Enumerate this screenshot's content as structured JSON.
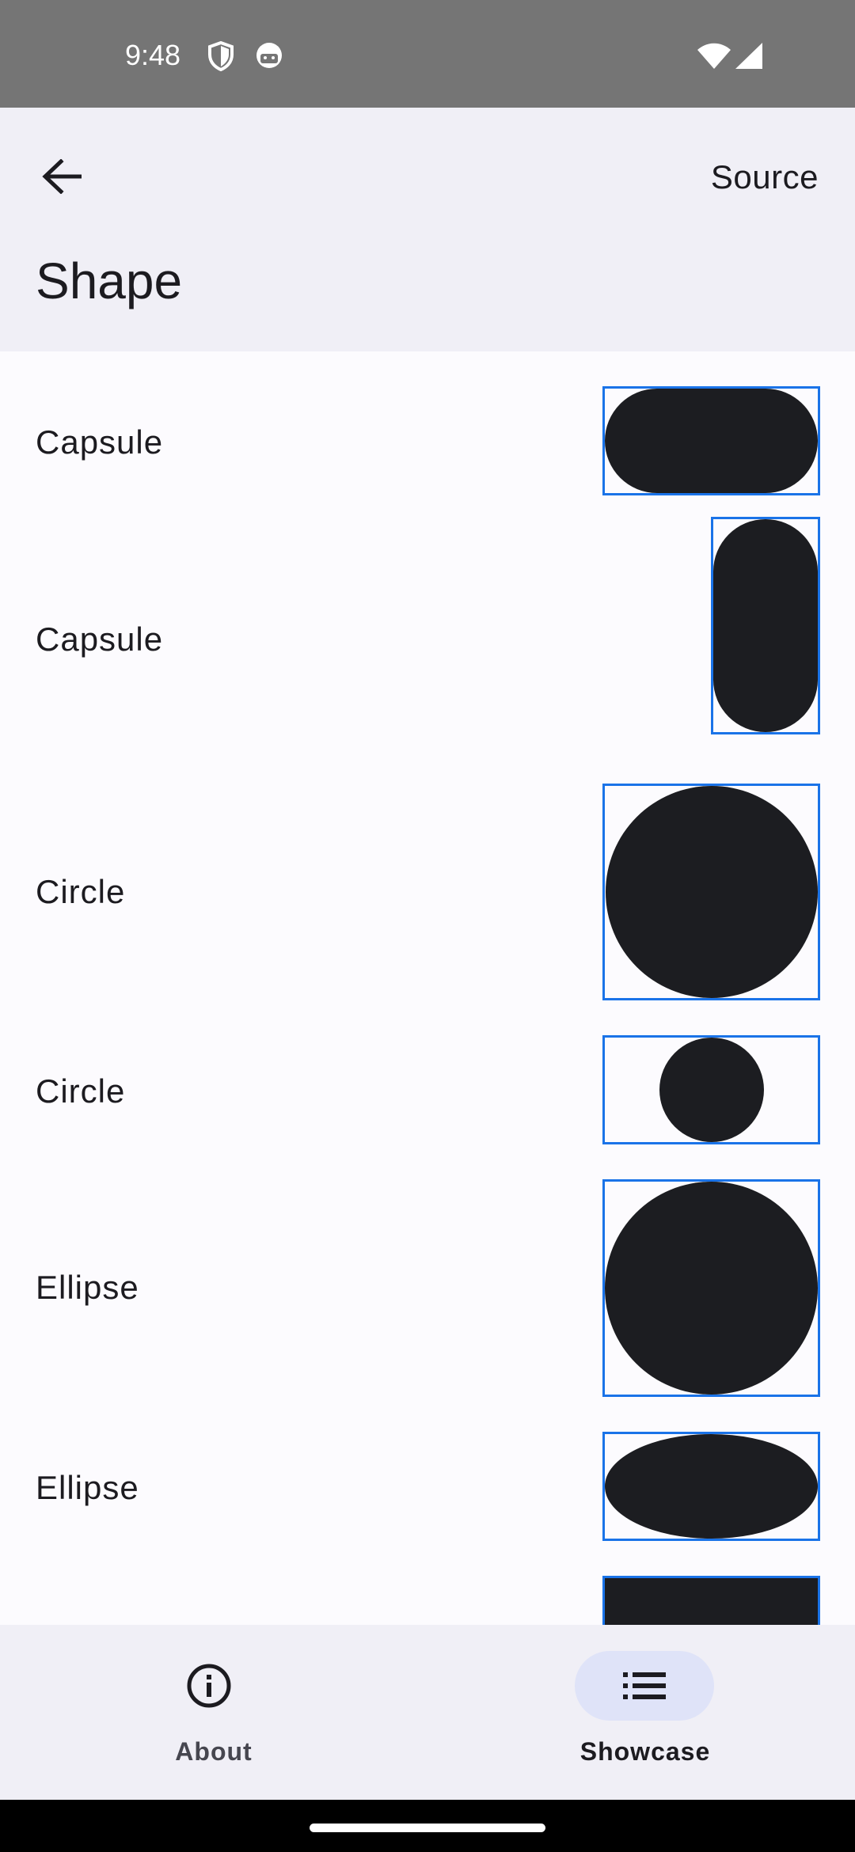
{
  "status_bar": {
    "time": "9:48",
    "icons": [
      "shield-icon",
      "android-face-icon",
      "wifi-icon",
      "signal-icon"
    ]
  },
  "top_bar": {
    "title": "Shape",
    "source_label": "Source",
    "back_icon": "arrow-left-icon"
  },
  "showcase_items": [
    {
      "label": "Capsule"
    },
    {
      "label": "Capsule"
    },
    {
      "label": "Circle"
    },
    {
      "label": "Circle"
    },
    {
      "label": "Ellipse"
    },
    {
      "label": "Ellipse"
    }
  ],
  "bottom_nav": {
    "items": [
      {
        "label": "About",
        "icon": "info-icon",
        "selected": false
      },
      {
        "label": "Showcase",
        "icon": "list-icon",
        "selected": true
      }
    ]
  },
  "colors": {
    "shape_fill": "#1c1d21",
    "frame_border": "#1a73e8",
    "top_bar_bg": "#f0eff6",
    "content_bg": "#fcfbfe",
    "nav_indicator": "#dfe3f8",
    "status_bar_bg": "#757575"
  }
}
